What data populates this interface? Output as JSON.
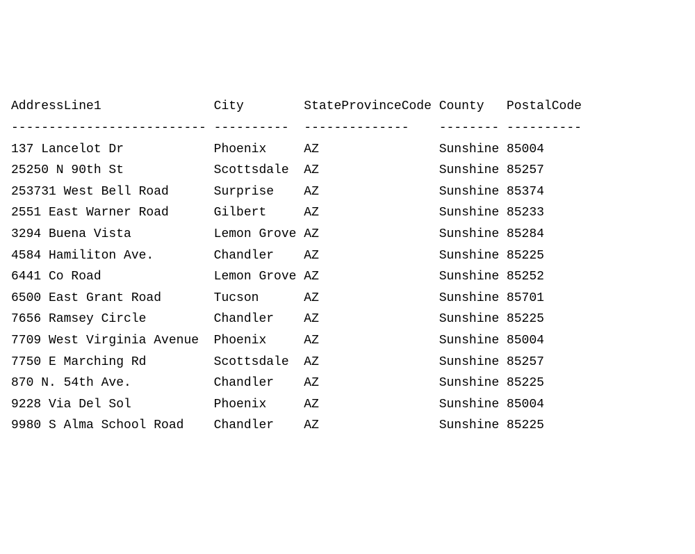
{
  "columns": {
    "address_line1": "AddressLine1",
    "city": "City",
    "state_province_code": "StateProvinceCode",
    "county": "County",
    "postal_code": "PostalCode"
  },
  "col_widths": {
    "address_line1": 27,
    "city": 12,
    "state_province_code": 18,
    "county": 9,
    "postal_code": 10
  },
  "dash_widths": {
    "address_line1": 26,
    "city": 10,
    "state_province_code": 14,
    "county": 8,
    "postal_code": 10
  },
  "chart_data": {
    "type": "table",
    "columns": [
      "AddressLine1",
      "City",
      "StateProvinceCode",
      "County",
      "PostalCode"
    ],
    "rows": [
      {
        "address_line1": "137 Lancelot Dr",
        "city": "Phoenix",
        "state_province_code": "AZ",
        "county": "Sunshine",
        "postal_code": "85004"
      },
      {
        "address_line1": "25250 N 90th St",
        "city": "Scottsdale",
        "state_province_code": "AZ",
        "county": "Sunshine",
        "postal_code": "85257"
      },
      {
        "address_line1": "253731 West Bell Road",
        "city": "Surprise",
        "state_province_code": "AZ",
        "county": "Sunshine",
        "postal_code": "85374"
      },
      {
        "address_line1": "2551 East Warner Road",
        "city": "Gilbert",
        "state_province_code": "AZ",
        "county": "Sunshine",
        "postal_code": "85233"
      },
      {
        "address_line1": "3294 Buena Vista",
        "city": "Lemon Grove",
        "state_province_code": "AZ",
        "county": "Sunshine",
        "postal_code": "85284"
      },
      {
        "address_line1": "4584 Hamiliton Ave.",
        "city": "Chandler",
        "state_province_code": "AZ",
        "county": "Sunshine",
        "postal_code": "85225"
      },
      {
        "address_line1": "6441 Co Road",
        "city": "Lemon Grove",
        "state_province_code": "AZ",
        "county": "Sunshine",
        "postal_code": "85252"
      },
      {
        "address_line1": "6500 East Grant Road",
        "city": "Tucson",
        "state_province_code": "AZ",
        "county": "Sunshine",
        "postal_code": "85701"
      },
      {
        "address_line1": "7656 Ramsey Circle",
        "city": "Chandler",
        "state_province_code": "AZ",
        "county": "Sunshine",
        "postal_code": "85225"
      },
      {
        "address_line1": "7709 West Virginia Avenue",
        "city": "Phoenix",
        "state_province_code": "AZ",
        "county": "Sunshine",
        "postal_code": "85004"
      },
      {
        "address_line1": "7750 E Marching Rd",
        "city": "Scottsdale",
        "state_province_code": "AZ",
        "county": "Sunshine",
        "postal_code": "85257"
      },
      {
        "address_line1": "870 N. 54th Ave.",
        "city": "Chandler",
        "state_province_code": "AZ",
        "county": "Sunshine",
        "postal_code": "85225"
      },
      {
        "address_line1": "9228 Via Del Sol",
        "city": "Phoenix",
        "state_province_code": "AZ",
        "county": "Sunshine",
        "postal_code": "85004"
      },
      {
        "address_line1": "9980 S Alma School Road",
        "city": "Chandler",
        "state_province_code": "AZ",
        "county": "Sunshine",
        "postal_code": "85225"
      }
    ]
  }
}
